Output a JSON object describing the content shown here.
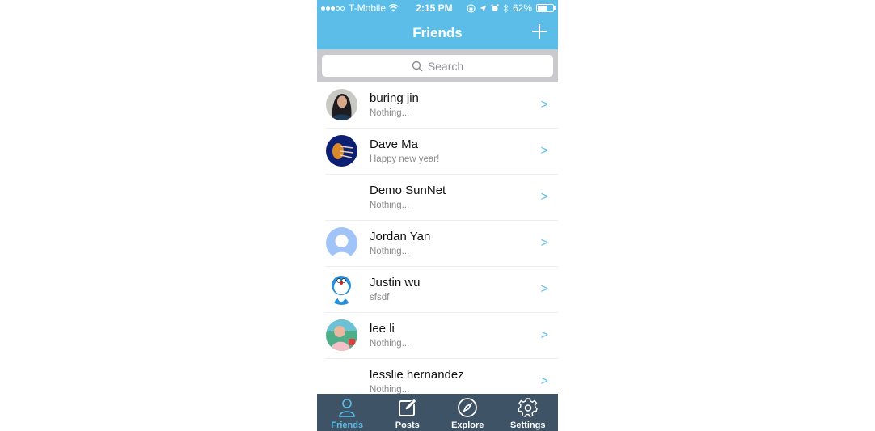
{
  "status_bar": {
    "signal_filled": 3,
    "signal_total": 5,
    "carrier": "T-Mobile",
    "time": "2:15 PM",
    "battery_percent": "62%",
    "battery_level": 0.62,
    "icons": [
      "wifi-icon",
      "orientation-lock-icon",
      "location-icon",
      "alarm-icon",
      "bluetooth-icon",
      "battery-icon"
    ]
  },
  "navbar": {
    "title": "Friends",
    "add_icon": "plus-icon"
  },
  "search": {
    "placeholder": "Search",
    "icon": "search-icon"
  },
  "friends": [
    {
      "name": "buring jin",
      "status": "Nothing...",
      "avatar": "photo-woman"
    },
    {
      "name": "Dave Ma",
      "status": "Happy new year!",
      "avatar": "photo-jellyfish"
    },
    {
      "name": "Demo SunNet",
      "status": "Nothing...",
      "avatar": "none"
    },
    {
      "name": "Jordan Yan",
      "status": "Nothing...",
      "avatar": "default-person"
    },
    {
      "name": "Justin wu",
      "status": "sfsdf",
      "avatar": "doraemon"
    },
    {
      "name": "lee li",
      "status": "Nothing...",
      "avatar": "photo-baby"
    },
    {
      "name": "lesslie hernandez",
      "status": "Nothing...",
      "avatar": "none"
    }
  ],
  "chevron": ">",
  "tabbar": {
    "tabs": [
      {
        "label": "Friends",
        "icon": "person-icon",
        "active": true
      },
      {
        "label": "Posts",
        "icon": "compose-icon",
        "active": false
      },
      {
        "label": "Explore",
        "icon": "compass-icon",
        "active": false
      },
      {
        "label": "Settings",
        "icon": "gear-icon",
        "active": false
      }
    ]
  },
  "colors": {
    "accent": "#5bbde8",
    "tabbar_bg": "#3e5366",
    "search_bg": "#c9c9ce"
  }
}
